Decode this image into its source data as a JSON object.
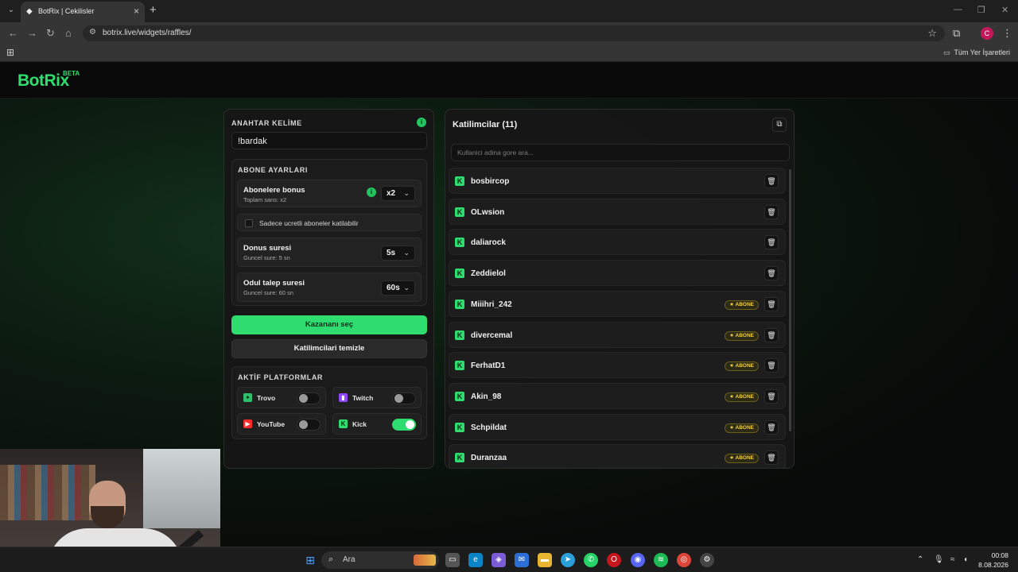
{
  "browser": {
    "tab_title": "BotRix | Cekilisler",
    "url": "botrix.live/widgets/raffles/",
    "bookmarks_all": "Tüm Yer İşaretleri",
    "profile_initial": "C"
  },
  "app": {
    "logo": "BotRix",
    "logo_badge": "BETA"
  },
  "settings": {
    "keyword_label": "ANAHTAR KELİME",
    "keyword_value": "!bardak",
    "sub_section_title": "ABONE AYARLARI",
    "sub_bonus": {
      "title": "Abonelere bonus",
      "subtitle": "Toplam sans: x2",
      "value": "x2"
    },
    "paid_only_label": "Sadece ucretli aboneler katilabilir",
    "spin_time": {
      "title": "Donus suresi",
      "subtitle": "Guncel sure: 5 sn",
      "value": "5s"
    },
    "claim_time": {
      "title": "Odul talep suresi",
      "subtitle": "Guncel sure: 60 sn",
      "value": "60s"
    },
    "pick_winner_label": "Kazananı seç",
    "clear_participants_label": "Katilimcilari temizle",
    "platforms_title": "AKTİF PLATFORMLAR",
    "platforms": [
      {
        "name": "Trovo",
        "enabled": false,
        "icon": "trovo-icon",
        "color": "#2fbf6f"
      },
      {
        "name": "Twitch",
        "enabled": false,
        "icon": "twitch-icon",
        "color": "#9146ff"
      },
      {
        "name": "YouTube",
        "enabled": false,
        "icon": "youtube-icon",
        "color": "#ff2b2b"
      },
      {
        "name": "Kick",
        "enabled": true,
        "icon": "kick-icon",
        "color": "#2fdc70"
      }
    ]
  },
  "participants": {
    "title": "Katilimcilar (11)",
    "search_placeholder": "Kullanici adina gore ara...",
    "badge_label": "★ ABONE",
    "items": [
      {
        "name": "bosbircop",
        "subscriber": false
      },
      {
        "name": "OLwsion",
        "subscriber": false
      },
      {
        "name": "daliarock",
        "subscriber": false
      },
      {
        "name": "Zeddielol",
        "subscriber": false
      },
      {
        "name": "Miiihri_242",
        "subscriber": true
      },
      {
        "name": "divercemal",
        "subscriber": true
      },
      {
        "name": "FerhatD1",
        "subscriber": true
      },
      {
        "name": "Akin_98",
        "subscriber": true
      },
      {
        "name": "Schpildat",
        "subscriber": true
      },
      {
        "name": "Duranzaa",
        "subscriber": true
      }
    ]
  },
  "taskbar": {
    "search_label": "Ara",
    "time": "00:08",
    "date": "8.08.2026"
  }
}
